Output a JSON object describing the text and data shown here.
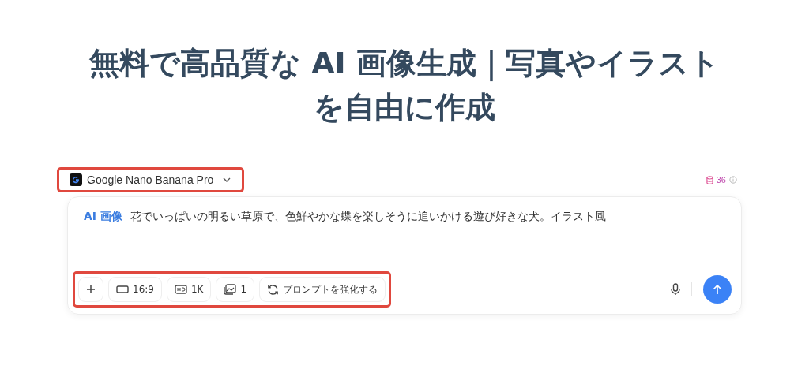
{
  "heading": "無料で高品質な AI 画像生成｜写真やイラストを自由に作成",
  "model": {
    "name": "Google Nano Banana Pro",
    "highlighted": true
  },
  "credits": "36",
  "prompt": {
    "tag": "AI 画像",
    "value": "花でいっぱいの明るい草原で、色鮮やかな蝶を楽しそうに追いかける遊び好きな犬。イラスト風"
  },
  "toolbar": {
    "highlighted": true,
    "items": [
      {
        "kind": "add"
      },
      {
        "kind": "ratio",
        "label": "16:9"
      },
      {
        "kind": "quality",
        "label": "1K"
      },
      {
        "kind": "count",
        "label": "1"
      },
      {
        "kind": "enhance",
        "label": "プロンプトを強化する"
      }
    ]
  }
}
